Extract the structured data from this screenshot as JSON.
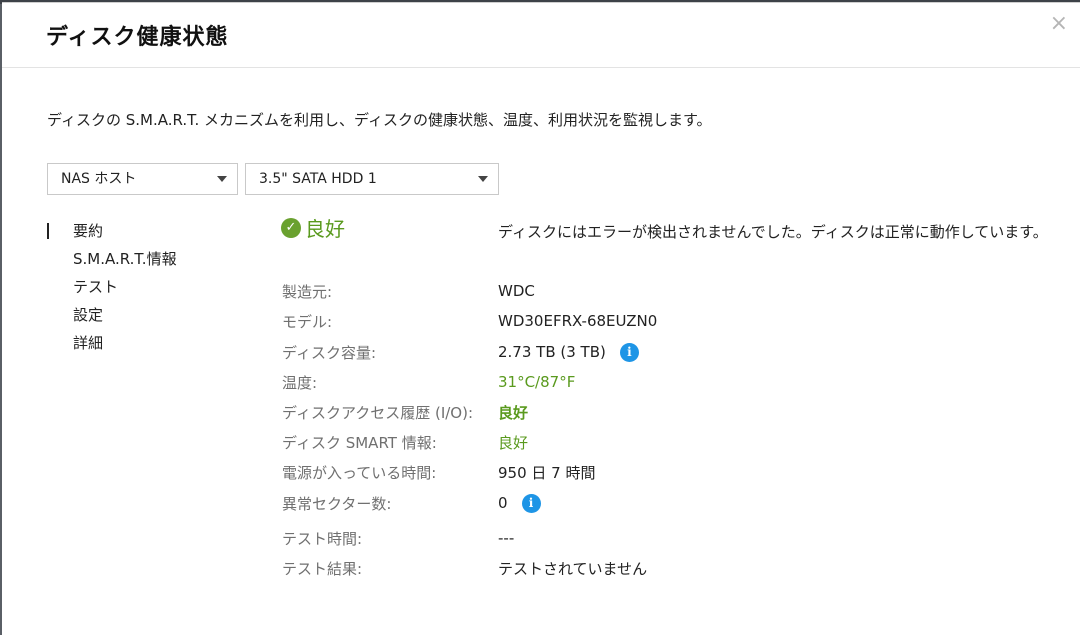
{
  "dialog": {
    "title": "ディスク健康状態",
    "close_glyph": "×"
  },
  "description": "ディスクの S.M.A.R.T. メカニズムを利用し、ディスクの健康状態、温度、利用状況を監視します。",
  "selects": {
    "host": "NAS ホスト",
    "disk": "3.5\" SATA HDD 1"
  },
  "sidebar": {
    "items": [
      {
        "label": "要約",
        "active": true
      },
      {
        "label": "S.M.A.R.T.情報",
        "active": false
      },
      {
        "label": "テスト",
        "active": false
      },
      {
        "label": "設定",
        "active": false
      },
      {
        "label": "詳細",
        "active": false
      }
    ]
  },
  "summary": {
    "status": "良好",
    "status_icon": "check-circle-icon",
    "status_message": "ディスクにはエラーが検出されませんでした。ディスクは正常に動作しています。",
    "rows": [
      {
        "label": "製造元:",
        "value": "WDC"
      },
      {
        "label": "モデル:",
        "value": "WD30EFRX-68EUZN0"
      },
      {
        "label": "ディスク容量:",
        "value": "2.73 TB (3 TB)",
        "info": "i"
      },
      {
        "label": "温度:",
        "value": "31°C/87°F"
      },
      {
        "label": "ディスクアクセス履歴 (I/O):",
        "value": "良好"
      },
      {
        "label": "ディスク SMART 情報:",
        "value": "良好"
      },
      {
        "label": "電源が入っている時間:",
        "value": "950 日 7 時間"
      },
      {
        "label": "異常セクター数:",
        "value": "0",
        "info": "i"
      },
      {
        "label": "テスト時間:",
        "value": "---"
      },
      {
        "label": "テスト結果:",
        "value": "テストされていません"
      }
    ]
  },
  "colors": {
    "good_green": "#5a9a1e",
    "info_blue": "#1e95e6",
    "label_gray": "#707070"
  }
}
